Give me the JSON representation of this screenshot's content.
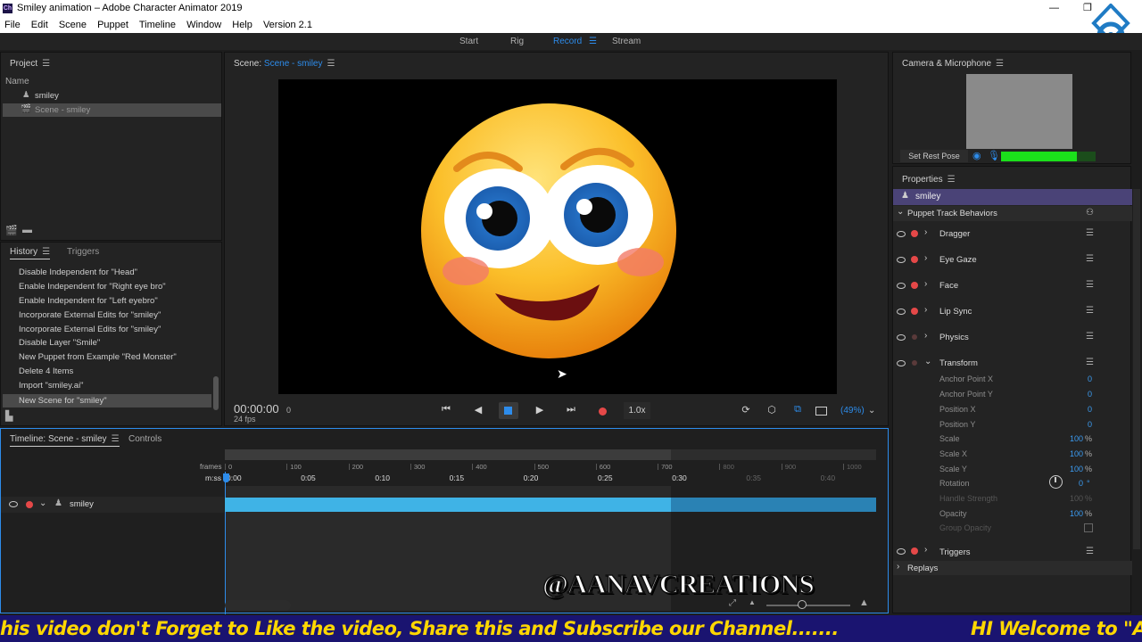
{
  "window": {
    "title": "Smiley animation – Adobe Character Animator 2019",
    "app_icon": "Ch"
  },
  "menu": [
    "File",
    "Edit",
    "Scene",
    "Puppet",
    "Timeline",
    "Window",
    "Help",
    "Version 2.1"
  ],
  "workspace_tabs": [
    "Start",
    "Rig",
    "Record",
    "Stream"
  ],
  "project": {
    "title": "Project",
    "col": "Name",
    "items": [
      "smiley",
      "Scene - smiley"
    ]
  },
  "history": {
    "tabs": [
      "History",
      "Triggers"
    ],
    "items": [
      "Disable Independent for \"Head\"",
      "Enable Independent for \"Right eye bro\"",
      "Enable Independent for \"Left eyebro\"",
      "Incorporate External Edits for \"smiley\"",
      "Incorporate External Edits for \"smiley\"",
      "Disable Layer \"Smile\"",
      "New Puppet from Example \"Red Monster\"",
      "Delete 4 Items",
      "Import \"smiley.ai\"",
      "New Scene for \"smiley\""
    ]
  },
  "scene": {
    "label": "Scene:",
    "name": "Scene - smiley",
    "timecode": "00:00:00",
    "frame": "0",
    "fps": "24 fps",
    "speed": "1.0x",
    "zoom": "(49%)"
  },
  "timeline": {
    "tab": "Timeline: Scene - smiley",
    "tab2": "Controls",
    "frames_label": "frames",
    "mss_label": "m:ss",
    "frame_ticks": [
      "0",
      "100",
      "200",
      "300",
      "400",
      "500",
      "600",
      "700",
      "800",
      "900",
      "1000"
    ],
    "time_ticks": [
      "0:00",
      "0:05",
      "0:10",
      "0:15",
      "0:20",
      "0:25",
      "0:30",
      "0:35",
      "0:40"
    ],
    "track": "smiley"
  },
  "camera": {
    "title": "Camera & Microphone",
    "rest_pose": "Set Rest Pose",
    "mic_level": 0.8
  },
  "properties": {
    "title": "Properties",
    "puppet": "smiley",
    "section": "Puppet Track Behaviors",
    "behaviors": [
      "Dragger",
      "Eye Gaze",
      "Face",
      "Lip Sync",
      "Physics",
      "Transform"
    ],
    "transform": [
      [
        "Anchor Point X",
        "0",
        ""
      ],
      [
        "Anchor Point Y",
        "0",
        ""
      ],
      [
        "Position X",
        "0",
        ""
      ],
      [
        "Position Y",
        "0",
        ""
      ],
      [
        "Scale",
        "100",
        "%"
      ],
      [
        "Scale X",
        "100",
        "%"
      ],
      [
        "Scale Y",
        "100",
        "%"
      ],
      [
        "Rotation",
        "0",
        "°"
      ],
      [
        "Handle Strength",
        "100",
        "%"
      ],
      [
        "Opacity",
        "100",
        "%"
      ],
      [
        "Group Opacity",
        "",
        ""
      ]
    ],
    "triggers": "Triggers",
    "replays": "Replays"
  },
  "overlay": {
    "watermark": "@AANAVCREATIONS",
    "ticker_left": "his video don't Forget to Like the video, Share this and Subscribe our Channel.......",
    "ticker_right": "HI Welcome to \"A"
  },
  "colors": {
    "accent": "#2d8ceb",
    "clip": "#3fb3e6",
    "ticker_bg": "#1a1470",
    "ticker_text": "#ffd700",
    "record": "#e54848"
  }
}
